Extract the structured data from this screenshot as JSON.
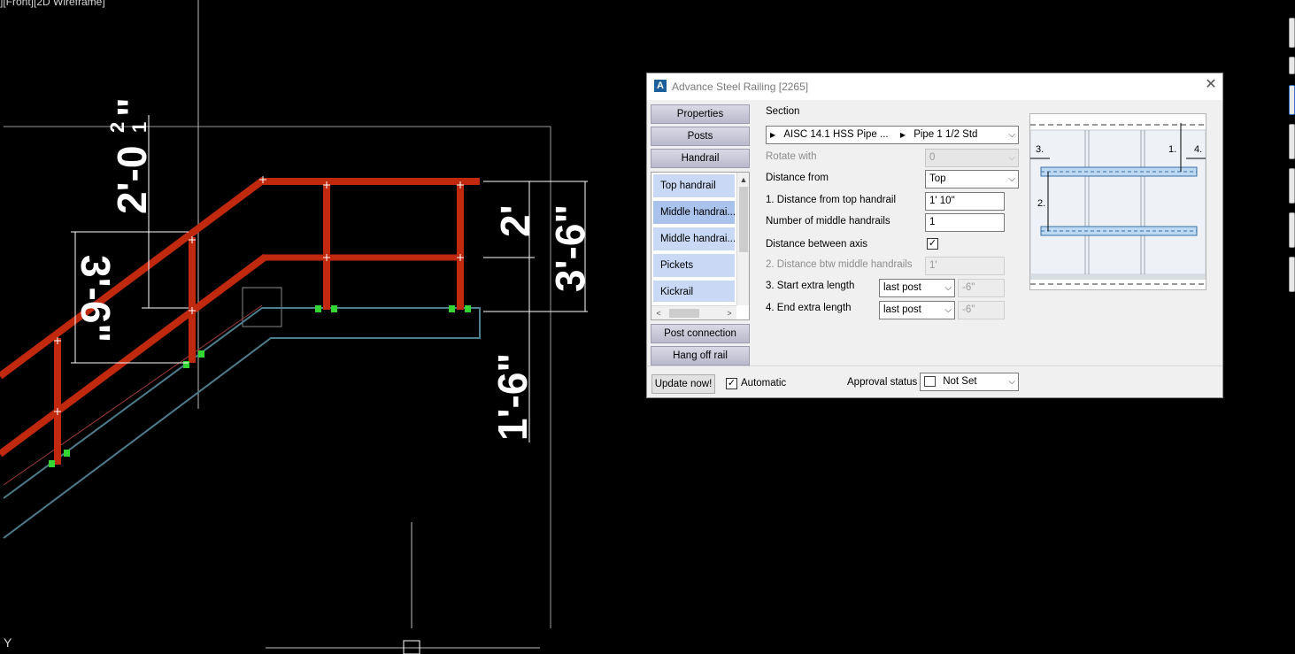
{
  "viewport": {
    "label": "][Front][2D Wireframe]",
    "ucs_y": "Y",
    "dimensions": {
      "top_dim": "2'-0",
      "top_dim_frac_num": "1",
      "top_dim_frac_den": "2",
      "top_dim_inch": "\"",
      "left_dim": "3'-6\"",
      "right_mid": "2'",
      "right_total": "3'-6\"",
      "lower": "1'-6\""
    },
    "colors": {
      "rail": "#c1290f",
      "stair": "#4e7d8e",
      "connector": "#33d633",
      "dimension": "#ffffff"
    }
  },
  "dialog": {
    "title": "Advance Steel  Railing [2265]",
    "close_icon": "close-icon",
    "tabs_top": [
      "Properties",
      "Posts",
      "Handrail"
    ],
    "subitems": [
      "Top handrail",
      "Middle handrai...",
      "Middle handrai...",
      "Pickets",
      "Kickrail"
    ],
    "selected_subitem": "Middle handrai...",
    "tabs_bottom": [
      "Post connection",
      "Hang off rail"
    ],
    "section": {
      "label": "Section",
      "path_1": "AISC 14.1 HSS Pipe ...",
      "path_2": "Pipe 1 1/2 Std"
    },
    "rotate_with": {
      "label": "Rotate with",
      "value": "0"
    },
    "distance_from": {
      "label": "Distance from",
      "value": "Top"
    },
    "dist_top_handrail": {
      "label": "1. Distance from top handrail",
      "value": "1' 10\""
    },
    "num_middle": {
      "label": "Number of middle handrails",
      "value": "1"
    },
    "dist_between_axis": {
      "label": "Distance between axis",
      "checked": true
    },
    "dist_btw_middle": {
      "label": "2. Distance btw middle handrails",
      "value": "1'"
    },
    "start_extra": {
      "label": "3. Start extra length",
      "mode": "last post",
      "value": "-6\""
    },
    "end_extra": {
      "label": "4. End extra length",
      "mode": "last post",
      "value": "-6\""
    },
    "preview_labels": [
      "1.",
      "2.",
      "3.",
      "4."
    ],
    "update_button": "Update now!",
    "automatic": {
      "label": "Automatic",
      "checked": true
    },
    "approval": {
      "label": "Approval status",
      "value": "Not Set"
    }
  }
}
